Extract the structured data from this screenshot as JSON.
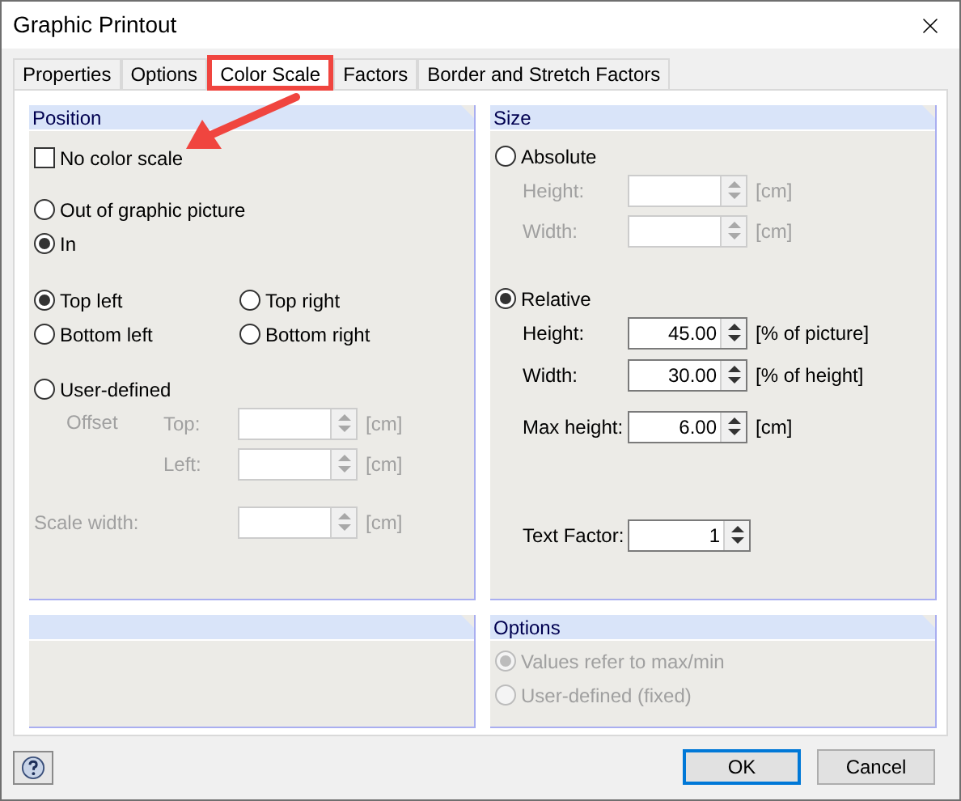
{
  "window": {
    "title": "Graphic Printout"
  },
  "tabs": [
    {
      "label": "Properties",
      "selected": false,
      "highlighted": false
    },
    {
      "label": "Options",
      "selected": false,
      "highlighted": false
    },
    {
      "label": "Color Scale",
      "selected": true,
      "highlighted": true
    },
    {
      "label": "Factors",
      "selected": false,
      "highlighted": false
    },
    {
      "label": "Border and Stretch Factors",
      "selected": false,
      "highlighted": false
    }
  ],
  "position": {
    "title": "Position",
    "no_color_scale": {
      "label": "No color scale",
      "checked": false
    },
    "placement": [
      {
        "label": "Out of graphic picture",
        "selected": false
      },
      {
        "label": "In",
        "selected": true
      }
    ],
    "corners": [
      {
        "label": "Top left",
        "selected": true
      },
      {
        "label": "Top right",
        "selected": false
      },
      {
        "label": "Bottom left",
        "selected": false
      },
      {
        "label": "Bottom right",
        "selected": false
      }
    ],
    "user_defined": {
      "label": "User-defined",
      "selected": false
    },
    "offset_label": {
      "text": "Offset",
      "disabled": true
    },
    "offset_fields": [
      {
        "label": "Top:",
        "unit": "[cm]",
        "disabled": true
      },
      {
        "label": "Left:",
        "unit": "[cm]",
        "disabled": true
      }
    ],
    "scale_width": {
      "label": "Scale width:",
      "unit": "[cm]",
      "disabled": true
    }
  },
  "size": {
    "title": "Size",
    "absolute": {
      "label": "Absolute",
      "selected": false
    },
    "absolute_fields": [
      {
        "label": "Height:",
        "unit": "[cm]",
        "disabled": true
      },
      {
        "label": "Width:",
        "unit": "[cm]",
        "disabled": true
      }
    ],
    "relative": {
      "label": "Relative",
      "selected": true
    },
    "relative_fields": [
      {
        "label": "Height:",
        "value": "45.00",
        "unit": "[% of picture]",
        "disabled": false
      },
      {
        "label": "Width:",
        "value": "30.00",
        "unit": "[% of height]",
        "disabled": false
      }
    ],
    "max_height": {
      "label": "Max height:",
      "value": "6.00",
      "unit": "[cm]",
      "disabled": false
    },
    "text_factor": {
      "label": "Text Factor:",
      "value": "1",
      "disabled": false
    }
  },
  "options": {
    "title": "Options",
    "choices": [
      {
        "label": "Values refer to max/min",
        "selected": true,
        "disabled": true
      },
      {
        "label": "User-defined (fixed)",
        "selected": false,
        "disabled": true
      }
    ]
  },
  "buttons": [
    {
      "label": "OK",
      "default": true
    },
    {
      "label": "Cancel",
      "default": false
    }
  ]
}
